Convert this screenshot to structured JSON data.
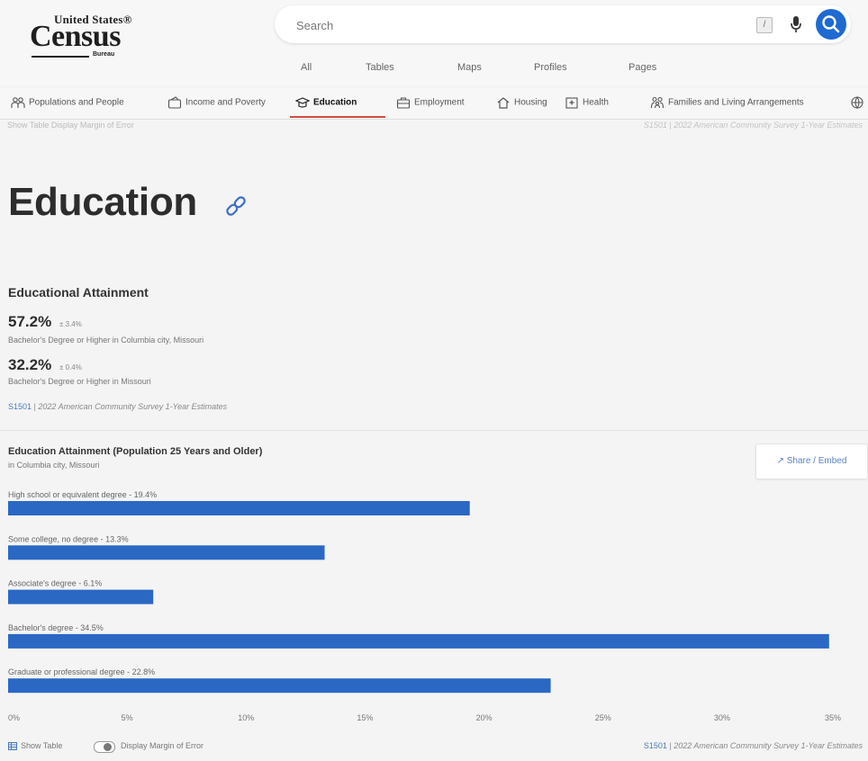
{
  "logo": {
    "top_text": "United States®",
    "main_text": "Census",
    "bureau_text": "Bureau"
  },
  "search": {
    "placeholder": "Search",
    "shortcut": "/"
  },
  "scope_tabs": [
    "All",
    "Tables",
    "Maps",
    "Profiles",
    "Pages"
  ],
  "topics": [
    {
      "label": "Populations and People",
      "icon": "people-icon"
    },
    {
      "label": "Income and Poverty",
      "icon": "wallet-icon"
    },
    {
      "label": "Education",
      "icon": "graduation-cap-icon",
      "active": true
    },
    {
      "label": "Employment",
      "icon": "briefcase-icon"
    },
    {
      "label": "Housing",
      "icon": "house-icon"
    },
    {
      "label": "Health",
      "icon": "hospital-icon"
    },
    {
      "label": "Families and Living Arrangements",
      "icon": "family-icon"
    }
  ],
  "page": {
    "title": "Education",
    "faint_left": "Show Table   Display Margin of Error",
    "faint_right": "S1501 | 2022 American Community Survey 1-Year Estimates"
  },
  "attainment": {
    "title": "Educational Attainment",
    "stats": [
      {
        "value": "57.2%",
        "moe": "± 3.4%",
        "desc": "Bachelor's Degree or Higher in Columbia city, Missouri"
      },
      {
        "value": "32.2%",
        "moe": "± 0.4%",
        "desc": "Bachelor's Degree or Higher in Missouri"
      }
    ],
    "source_link": "S1501",
    "source_desc": "2022 American Community Survey 1-Year Estimates"
  },
  "chart": {
    "title": "Education Attainment (Population 25 Years and Older)",
    "subtitle": "in Columbia city, Missouri",
    "share_label": "↗ Share / Embed"
  },
  "chart_data": {
    "type": "bar",
    "orientation": "horizontal",
    "categories": [
      "High school or equivalent degree",
      "Some college, no degree",
      "Associate's degree",
      "Bachelor's degree",
      "Graduate or professional degree"
    ],
    "bar_labels": [
      "High school or equivalent degree - 19.4%",
      "Some college, no degree - 13.3%",
      "Associate's degree - 6.1%",
      "Bachelor's degree - 34.5%",
      "Graduate or professional degree - 22.8%"
    ],
    "values": [
      19.4,
      13.3,
      6.1,
      34.5,
      22.8
    ],
    "xlim": [
      0,
      35
    ],
    "xticks": [
      "0%",
      "5%",
      "10%",
      "15%",
      "20%",
      "25%",
      "30%",
      "35%"
    ],
    "bar_color": "#2a68c4",
    "grid": false
  },
  "footer": {
    "show_table": "Show Table",
    "moe_label": "Display Margin of Error",
    "source_link": "S1501",
    "source_desc": "2022 American Community Survey 1-Year Estimates"
  },
  "colors": {
    "accent": "#1e6ad1",
    "bar": "#2a68c4",
    "active_tab_underline": "#d34a3e"
  }
}
